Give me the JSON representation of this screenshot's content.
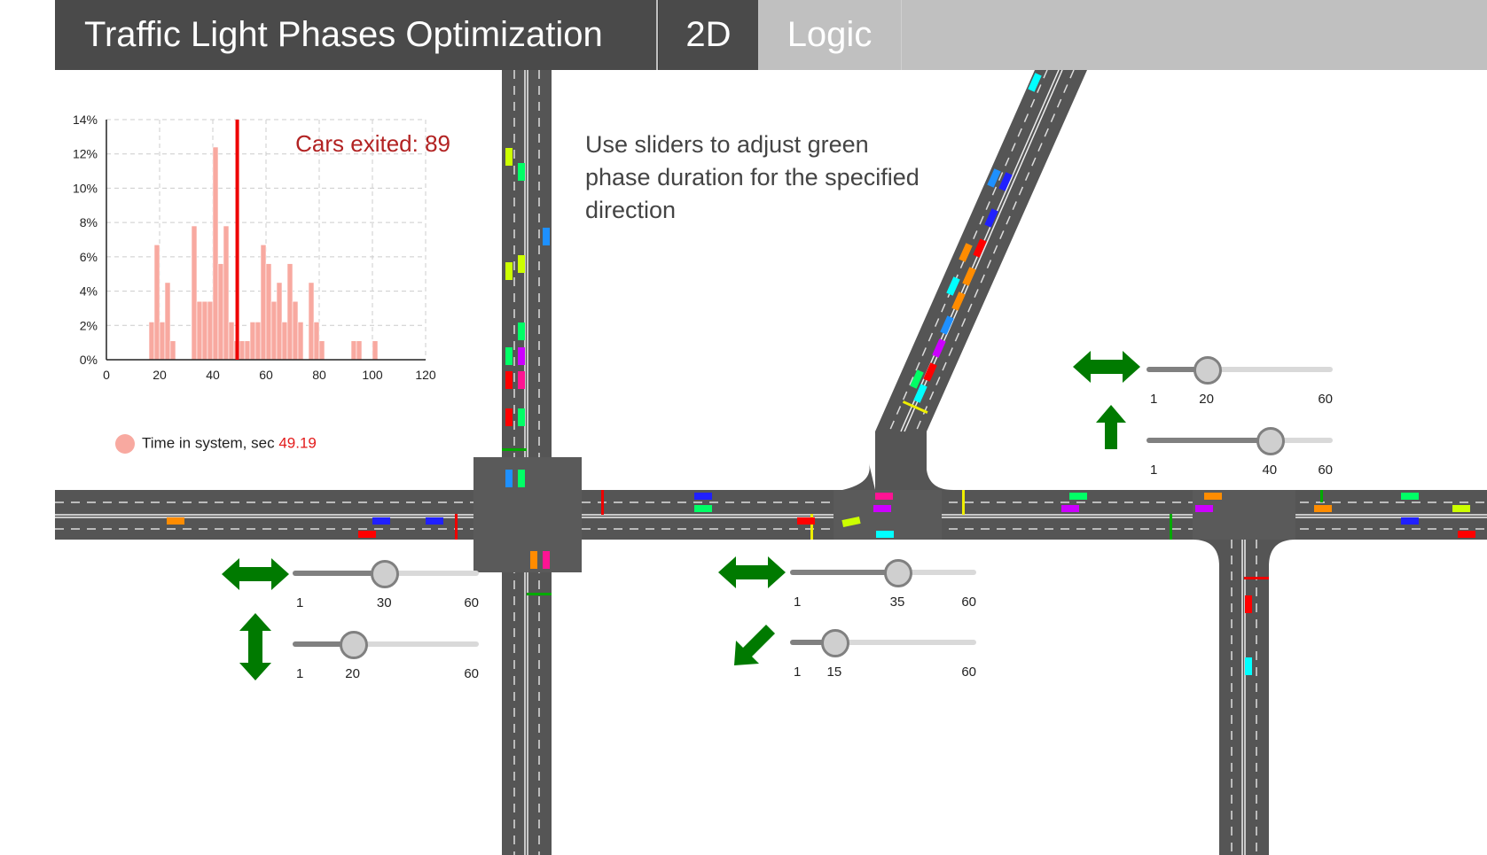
{
  "header": {
    "title": "Traffic Light Phases Optimization",
    "tab_2d": "2D",
    "tab_logic": "Logic"
  },
  "hint": "Use sliders to adjust green phase duration for the specified direction",
  "colors": {
    "header_dark": "#4a4a4a",
    "header_light": "#c0c0c0",
    "road": "#555555",
    "arrow_green": "#007a00",
    "bar_fill": "#f8a9a0",
    "mean_line": "#ee0000",
    "exited_text": "#b22222"
  },
  "chart_data": {
    "type": "bar",
    "x": [
      17,
      19,
      21,
      23,
      25,
      33,
      35,
      37,
      39,
      41,
      43,
      45,
      47,
      49,
      51,
      53,
      55,
      57,
      59,
      61,
      63,
      65,
      67,
      69,
      71,
      73,
      77,
      79,
      81,
      93,
      95,
      101
    ],
    "values": [
      2.2,
      6.7,
      2.2,
      4.5,
      1.1,
      7.8,
      3.4,
      3.4,
      3.4,
      12.4,
      5.6,
      7.8,
      2.2,
      1.1,
      1.1,
      1.1,
      2.2,
      2.2,
      6.7,
      5.6,
      3.4,
      4.5,
      2.2,
      5.6,
      3.4,
      2.2,
      4.5,
      2.2,
      1.1,
      1.1,
      1.1,
      1.1
    ],
    "bin_width": 2,
    "xlim": [
      0,
      120
    ],
    "ylim": [
      0,
      14
    ],
    "xticks": [
      "0",
      "20",
      "40",
      "60",
      "80",
      "100",
      "120"
    ],
    "yticks": [
      "0%",
      "2%",
      "4%",
      "6%",
      "8%",
      "10%",
      "12%",
      "14%"
    ],
    "grid": true,
    "mean_x": 49.19,
    "annotation": "Cars exited: 89",
    "legend": {
      "label": "Time in system, sec",
      "value": "49.19"
    }
  },
  "sliders": [
    {
      "id": "left-horizontal",
      "direction": "horizontal",
      "min": 1,
      "max": 60,
      "value": 30,
      "min_label": "1",
      "value_label": "30",
      "max_label": "60"
    },
    {
      "id": "left-vertical",
      "direction": "vertical",
      "min": 1,
      "max": 60,
      "value": 20,
      "min_label": "1",
      "value_label": "20",
      "max_label": "60"
    },
    {
      "id": "middle-horizontal",
      "direction": "horizontal",
      "min": 1,
      "max": 60,
      "value": 35,
      "min_label": "1",
      "value_label": "35",
      "max_label": "60"
    },
    {
      "id": "middle-diagonal",
      "direction": "down-left",
      "min": 1,
      "max": 60,
      "value": 15,
      "min_label": "1",
      "value_label": "15",
      "max_label": "60"
    },
    {
      "id": "right-horizontal",
      "direction": "horizontal",
      "min": 1,
      "max": 60,
      "value": 20,
      "min_label": "1",
      "value_label": "20",
      "max_label": "60"
    },
    {
      "id": "right-up",
      "direction": "up",
      "min": 1,
      "max": 60,
      "value": 40,
      "min_label": "1",
      "value_label": "40",
      "max_label": "60"
    }
  ]
}
